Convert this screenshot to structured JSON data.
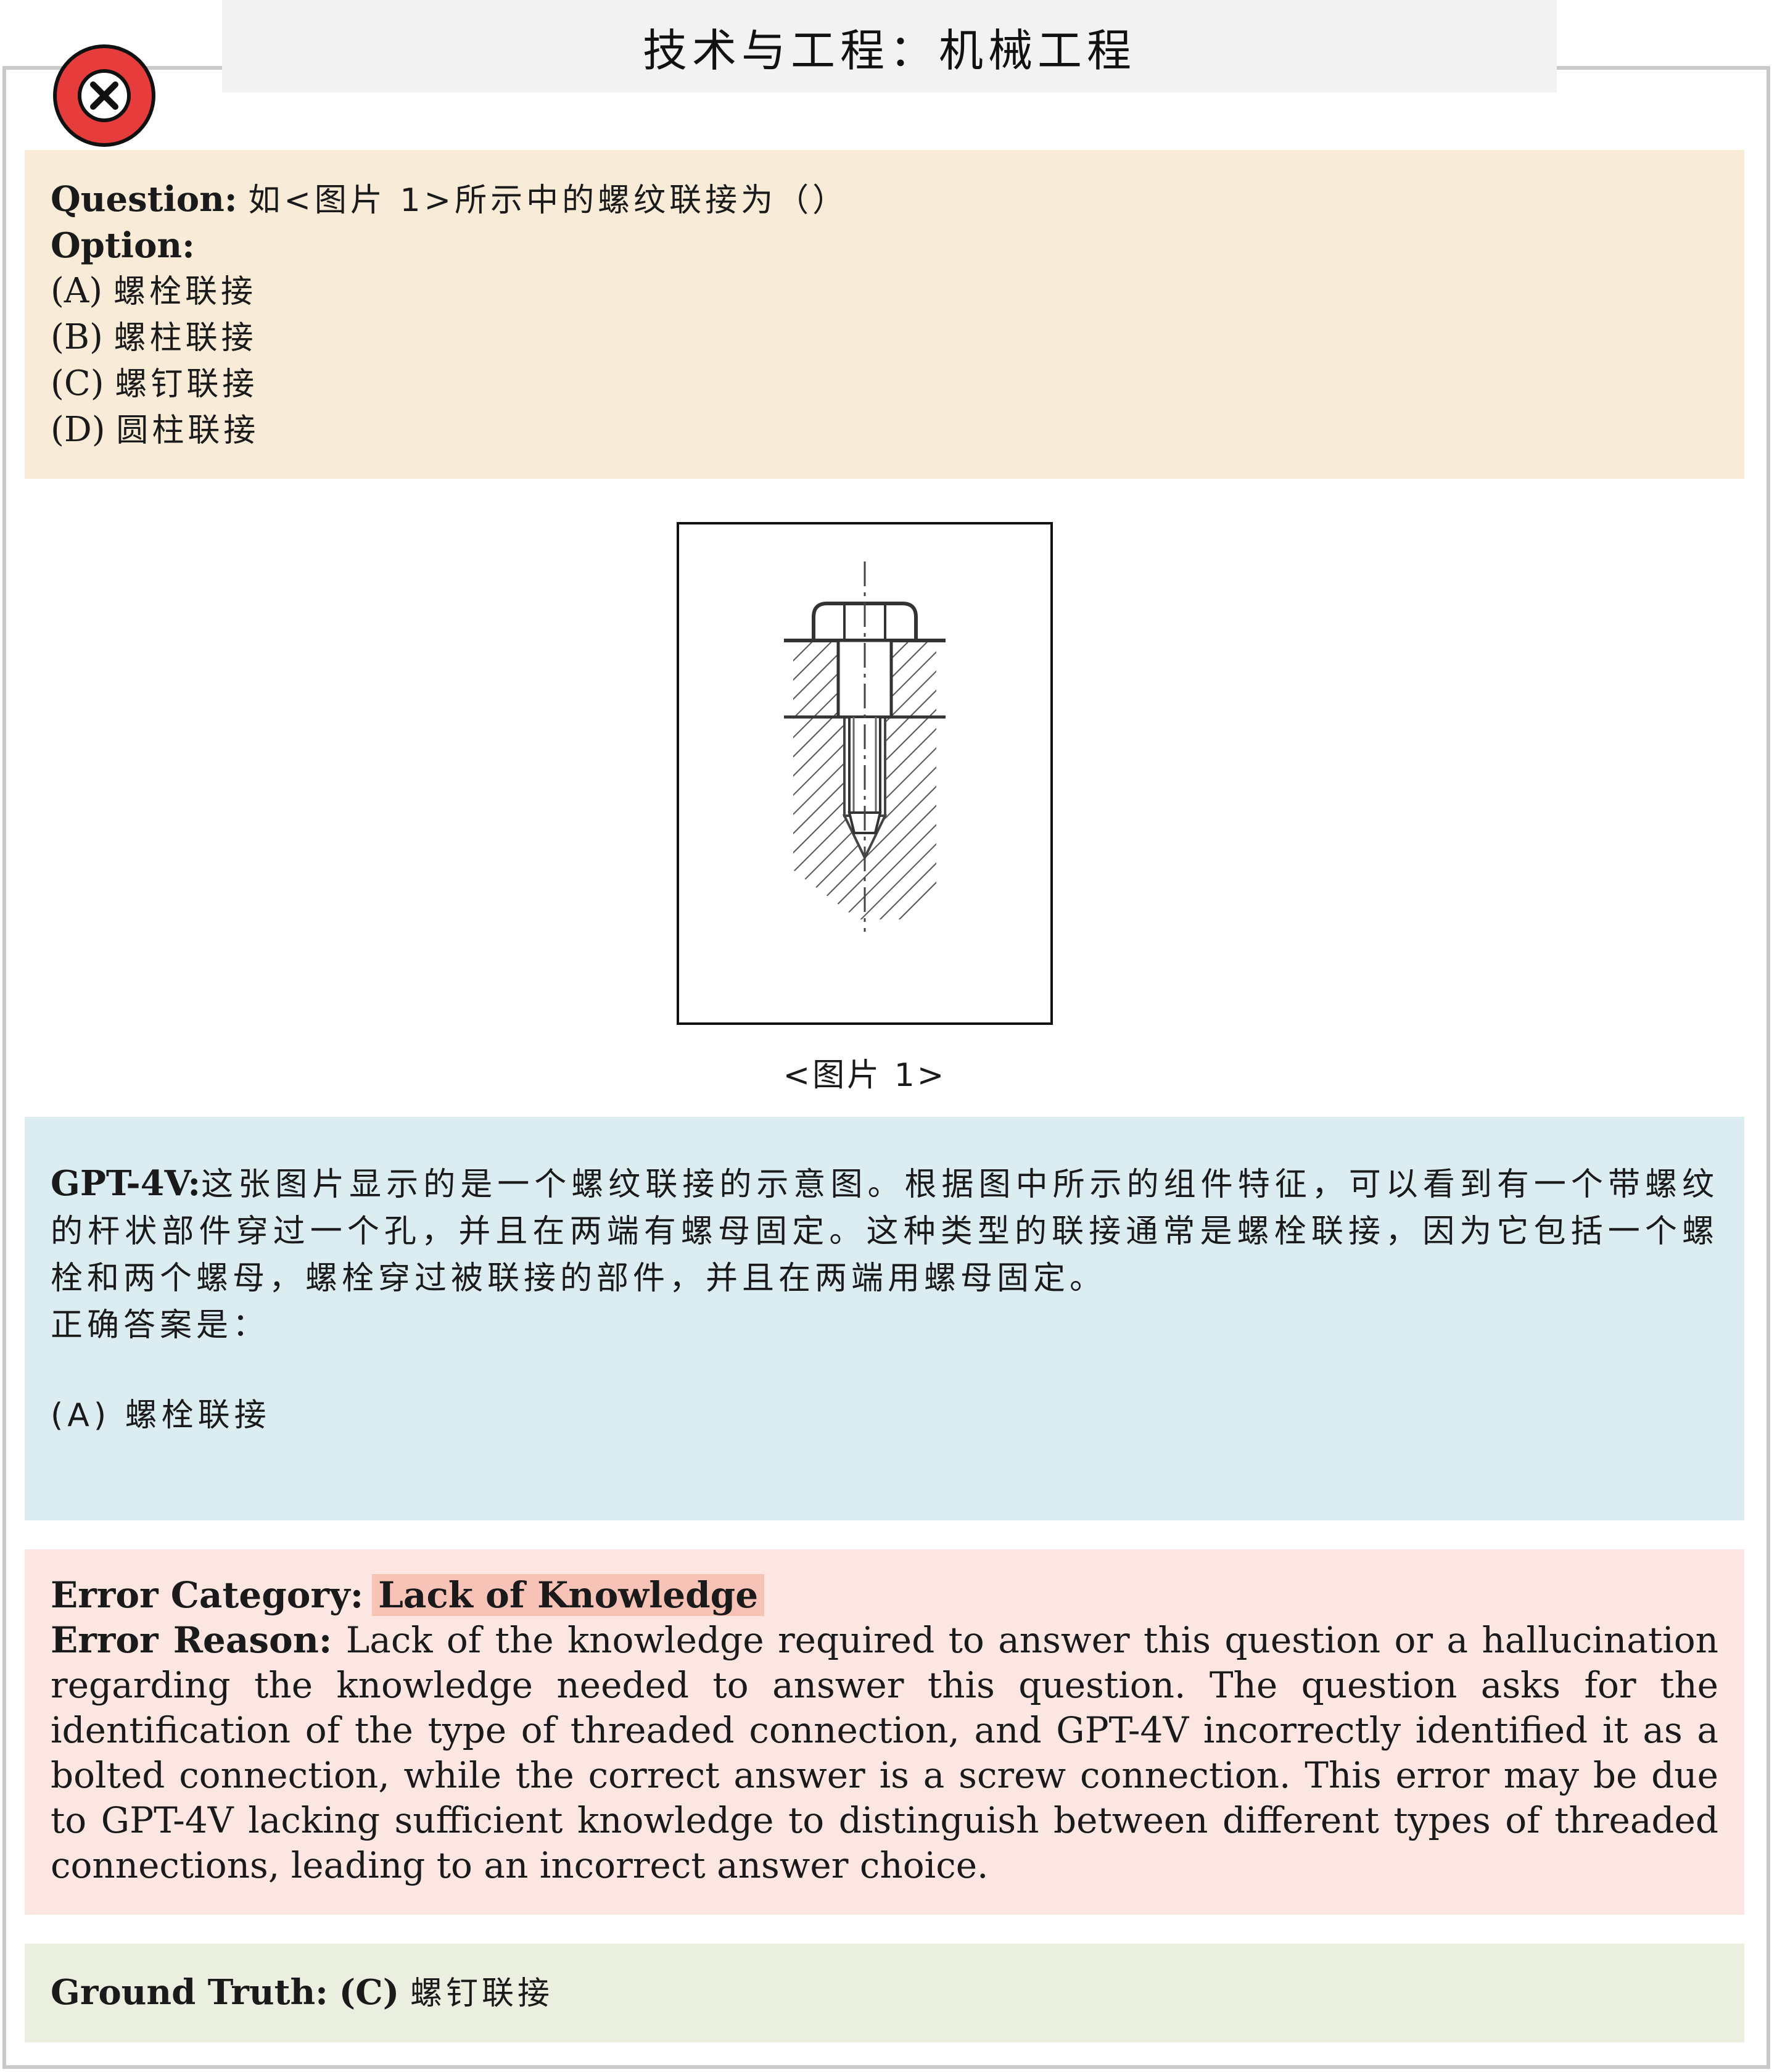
{
  "header": {
    "title": "技术与工程：机械工程"
  },
  "status": {
    "icon": "x-circle-icon",
    "color": "#e63c3c"
  },
  "question": {
    "label": "Question:",
    "text": "如<图片 1>所示中的螺纹联接为（）",
    "option_label": "Option:",
    "options": [
      {
        "key": "(A)",
        "text": "螺栓联接"
      },
      {
        "key": "(B)",
        "text": "螺柱联接"
      },
      {
        "key": "(C)",
        "text": "螺钉联接"
      },
      {
        "key": "(D)",
        "text": "圆柱联接"
      }
    ]
  },
  "figure": {
    "caption": "<图片 1>"
  },
  "answer": {
    "label": "GPT-4V:",
    "text": "这张图片显示的是一个螺纹联接的示意图。根据图中所示的组件特征，可以看到有一个带螺纹的杆状部件穿过一个孔，并且在两端有螺母固定。这种类型的联接通常是螺栓联接，因为它包括一个螺栓和两个螺母，螺栓穿过被联接的部件，并且在两端用螺母固定。",
    "conclusion": "正确答案是：",
    "choice": "(A) 螺栓联接"
  },
  "error": {
    "category_label": "Error Category:",
    "category": "Lack of Knowledge",
    "reason_label": "Error Reason:",
    "reason": "Lack of the knowledge required to answer this question or a hallucination regarding the knowledge needed to answer this question. The question asks for the identification of the type of threaded connection, and GPT-4V incorrectly identified it as a bolted connection, while the correct answer is a screw connection. This error may be due to GPT-4V lacking sufficient knowledge to distinguish between different types of threaded connections, leading to an incorrect answer choice."
  },
  "ground_truth": {
    "label": "Ground Truth:",
    "key": "(C)",
    "text": "螺钉联接"
  },
  "colors": {
    "question_bg": "#f8ebd7",
    "answer_bg": "#dcedf1",
    "error_bg": "#fbe6e1",
    "truth_bg": "#ebefdf",
    "category_highlight": "#f7c3b6"
  }
}
